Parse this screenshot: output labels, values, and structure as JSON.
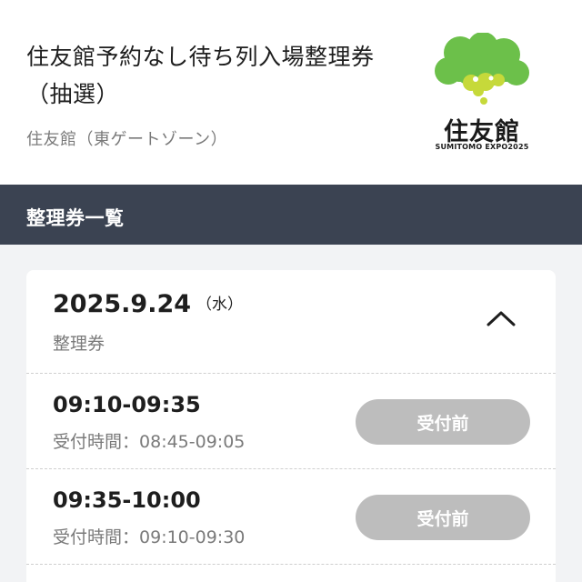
{
  "header": {
    "title": "住友館予約なし待ち列入場整理券（抽選）",
    "subtitle": "住友館（東ゲートゾーン）",
    "logo": {
      "name": "住友館",
      "sub": "SUMITOMO EXPO2025",
      "colors": {
        "green": "#6cc04a",
        "yellow": "#c6d93a",
        "text": "#1a1a1a"
      }
    }
  },
  "section": {
    "title": "整理券一覧"
  },
  "card": {
    "date": "2025.9.24",
    "weekday": "（水）",
    "ticket_type": "整理券",
    "expanded_icon": "chevron-up-icon",
    "slots": [
      {
        "time": "09:10-09:35",
        "reception_label": "受付時間：",
        "reception": "08:45-09:05",
        "button": "受付前"
      },
      {
        "time": "09:35-10:00",
        "reception_label": "受付時間：",
        "reception": "09:10-09:30",
        "button": "受付前"
      }
    ]
  },
  "colors": {
    "section_bar": "#3b4352",
    "button_disabled": "#bdbdbd",
    "muted_text": "#7a7a7a",
    "page_bg": "#f2f3f5"
  }
}
